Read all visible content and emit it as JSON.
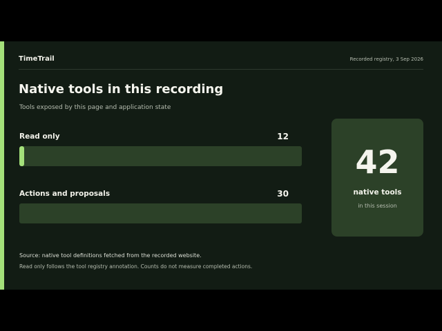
{
  "header": {
    "app_name": "TimeTrail",
    "record_info": "Recorded registry, 3 Sep 2026"
  },
  "main": {
    "title": "Native tools in this recording",
    "subtitle": "Tools exposed by this page and application state",
    "metrics": [
      {
        "label": "Read only",
        "value": "12",
        "fraction": 0.017
      },
      {
        "label": "Actions and proposals",
        "value": "30",
        "fraction": 0.0
      }
    ]
  },
  "summary": {
    "number": "42",
    "label": "native tools",
    "sublabel": "in this session"
  },
  "footer": {
    "source": "Source: native tool definitions fetched from the recorded website.",
    "note": "Read only follows the tool registry annotation. Counts do not measure completed actions."
  },
  "colors": {
    "accent": "#a4e07a",
    "background": "#121c14",
    "track": "#2c4128"
  }
}
